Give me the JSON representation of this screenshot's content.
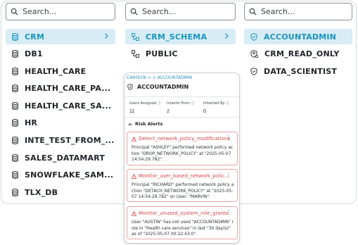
{
  "columns": [
    {
      "search_placeholder": "Search...",
      "items": [
        {
          "label": "CRM",
          "selected": true,
          "chevron": true
        },
        {
          "label": "DB1"
        },
        {
          "label": "HEALTH_CARE"
        },
        {
          "label": "HEALTH_CARE_PA..."
        },
        {
          "label": "HEALTH_CARE_SA..."
        },
        {
          "label": "HR"
        },
        {
          "label": "INTE_TEST_FROM_..."
        },
        {
          "label": "SALES_DATAMART"
        },
        {
          "label": "SNOWFLAKE_SAM..."
        },
        {
          "label": "TLX_DB"
        }
      ]
    },
    {
      "search_placeholder": "Search...",
      "items": [
        {
          "label": "CRM_SCHEMA",
          "selected": true,
          "chevron": true
        },
        {
          "label": "PUBLIC"
        }
      ]
    },
    {
      "search_placeholder": "Search...",
      "items": [
        {
          "label": "ACCOUNTADMIN",
          "selected": true
        },
        {
          "label": "CRM_READ_ONLY"
        },
        {
          "label": "DATA_SCIENTIST"
        }
      ]
    }
  ],
  "card": {
    "breadcrumb": "CAROLYN > > ACCOUNTADMIN",
    "title": "ACCOUNTADMIN",
    "stats": [
      {
        "label": "Users Assigned",
        "value": "11"
      },
      {
        "label": "Inherits From",
        "value": "2"
      },
      {
        "label": "Inherited By",
        "value": "0"
      }
    ],
    "risk_heading": "Risk Alerts",
    "alerts": [
      {
        "name": "Detect_network_policy_modifications",
        "description": "Principal \"ASHLEY\" performed network policy action \"DROP_NETWORK_POLICY\" at \"2025-05-07 14:54:29.782\"."
      },
      {
        "name": "Monitor_user_based_network_polic...",
        "description": "Principal \"RICHARD\" performed network policy action \"DETACH_NETWORK_POLICY\" at \"2025-05-07 14:54:29.782\" on User: \"MARVIN\"."
      },
      {
        "name": "Monitor_unused_system_role_grants",
        "description": "User \"AUSTIN\" has not used \"ACCOUNTADMIN\" role in \"Health care services\" in last \"30 day(s)\" as of \"2025-05-07 00:22:43.0\"."
      }
    ]
  },
  "colors": {
    "accent": "#1a94c0",
    "selected_bg": "#d7ecf4",
    "alert": "#d64545"
  }
}
